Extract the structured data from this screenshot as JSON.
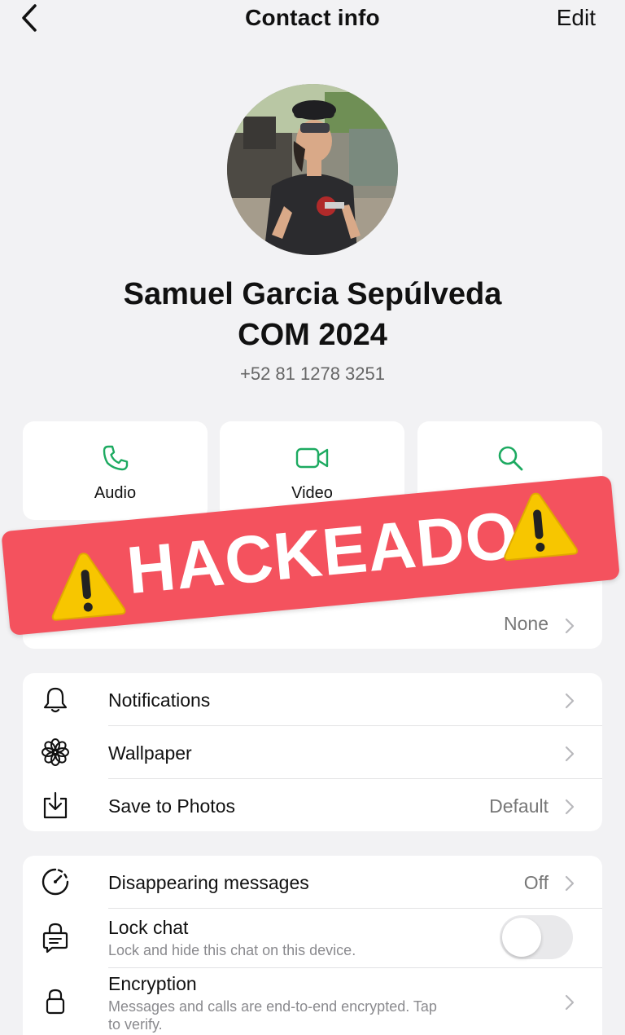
{
  "nav": {
    "title": "Contact info",
    "edit": "Edit"
  },
  "contact": {
    "name_line1": "Samuel Garcia Sepúlveda",
    "name_line2": "COM 2024",
    "phone": "+52 81 1278 3251"
  },
  "actions": [
    {
      "label": "Audio",
      "icon": "phone-icon"
    },
    {
      "label": "Video",
      "icon": "video-icon"
    },
    {
      "label": "Search",
      "icon": "search-icon"
    }
  ],
  "overlay": {
    "text": "HACKEADO",
    "icon": "warning-icon"
  },
  "media_row": {
    "value": "None"
  },
  "settings": [
    {
      "label": "Notifications",
      "value": "",
      "icon": "bell-icon"
    },
    {
      "label": "Wallpaper",
      "value": "",
      "icon": "flower-icon"
    },
    {
      "label": "Save to Photos",
      "value": "Default",
      "icon": "download-icon"
    }
  ],
  "privacy": {
    "disappearing": {
      "label": "Disappearing messages",
      "value": "Off",
      "icon": "timer-icon"
    },
    "lock_chat": {
      "label": "Lock chat",
      "sub": "Lock and hide this chat on this device.",
      "enabled": false,
      "icon": "lock-chat-icon"
    },
    "encryption": {
      "label": "Encryption",
      "sub_line1": "Messages and calls are end-to-end encrypted. Tap",
      "sub_line2": "to verify.",
      "icon": "lock-icon"
    }
  },
  "colors": {
    "accent": "#1daa61",
    "banner": "#f4525e",
    "warning": "#f7c600"
  }
}
